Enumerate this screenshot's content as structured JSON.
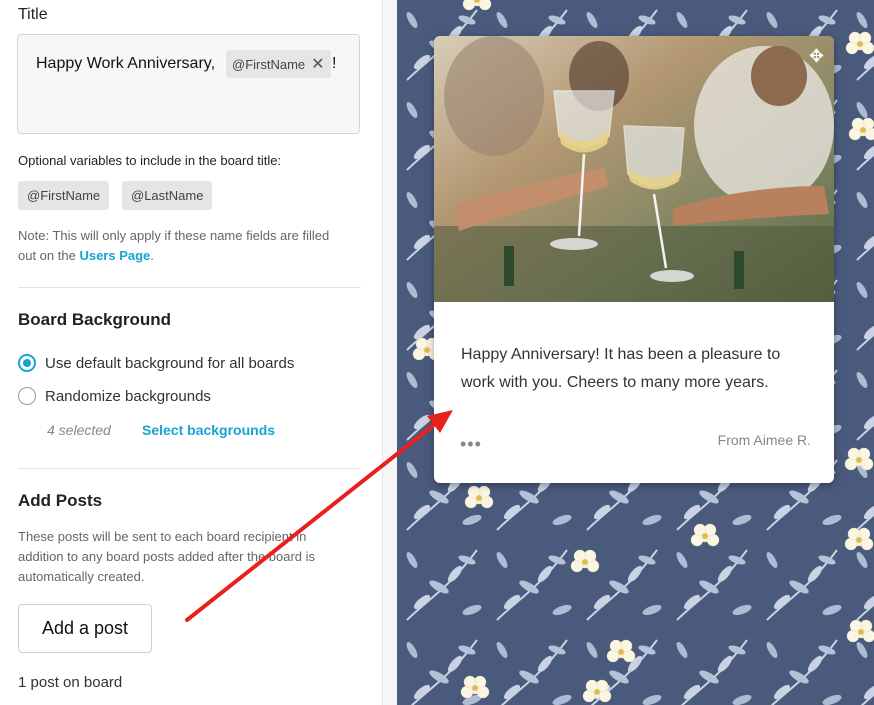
{
  "title_section": {
    "label": "Title",
    "text_before": "Happy Work Anniversary,",
    "variable_chip": "@FirstName",
    "chip_remove": "✕",
    "text_after": "!"
  },
  "variables": {
    "label": "Optional variables to include in the board title:",
    "items": [
      "@FirstName",
      "@LastName"
    ]
  },
  "note": {
    "text": "Note: This will only apply if these name fields are filled out on the",
    "link": "Users Page",
    "end": "."
  },
  "background": {
    "heading": "Board Background",
    "options": [
      "Use default background for all boards",
      "Randomize backgrounds"
    ],
    "selected_index": 0,
    "selected_count": "4 selected",
    "select_link": "Select backgrounds"
  },
  "posts": {
    "heading": "Add Posts",
    "description": "These posts will be sent to each board recipient in addition to any board posts added after the board is automatically created.",
    "add_button": "Add a post",
    "count": "1 post on board"
  },
  "preview_card": {
    "move_icon": "move-icon",
    "message": "Happy Anniversary! It has been a pleasure to work with you. Cheers to many more years.",
    "more_dots": "•••",
    "from": "From Aimee R."
  },
  "colors": {
    "accent": "#17a3d6",
    "background_pattern": "#4a5a7d",
    "arrow": "#e8211d"
  }
}
